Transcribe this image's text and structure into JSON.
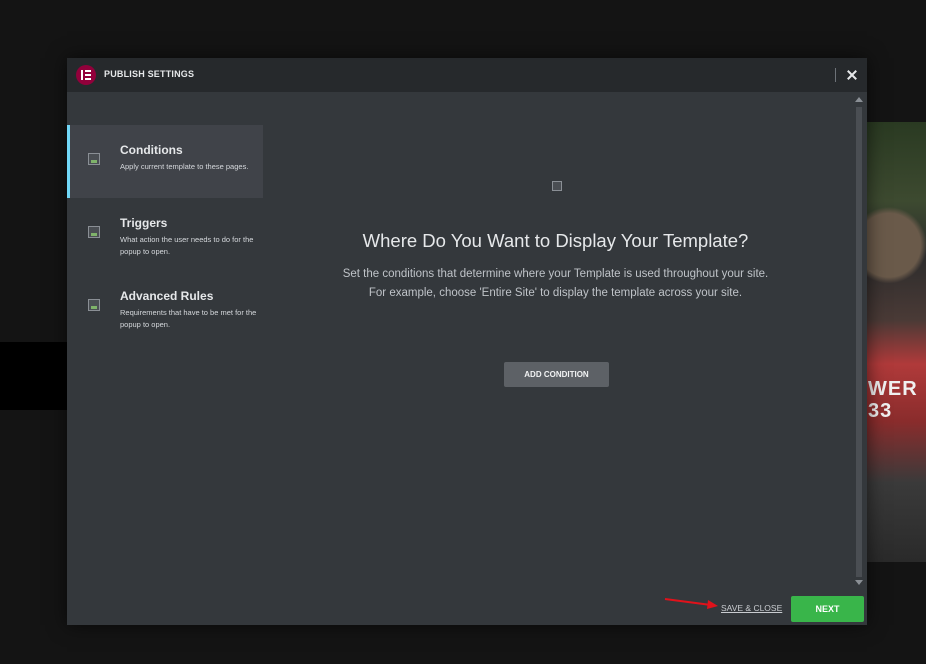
{
  "dialog": {
    "title": "PUBLISH SETTINGS",
    "logo_icon": "elementor-logo-icon",
    "close_icon": "close-icon"
  },
  "sidebar": {
    "items": [
      {
        "title": "Conditions",
        "description": "Apply current template to these pages.",
        "active": true
      },
      {
        "title": "Triggers",
        "description": "What action the user needs to do for the popup to open.",
        "active": false
      },
      {
        "title": "Advanced Rules",
        "description": "Requirements that have to be met for the popup to open.",
        "active": false
      }
    ]
  },
  "main": {
    "heading": "Where Do You Want to Display Your Template?",
    "description_line1": "Set the conditions that determine where your Template is used throughout your site.",
    "description_line2": "For example, choose 'Entire Site' to display the template across your site.",
    "add_condition_label": "ADD CONDITION"
  },
  "footer": {
    "save_close_label": "SAVE & CLOSE",
    "next_label": "NEXT"
  },
  "background": {
    "jersey_text": "WER\n33"
  },
  "colors": {
    "accent_blue": "#71d7f7",
    "next_green": "#39b54a",
    "logo_maroon": "#92003b",
    "annotation_red": "#e0121b"
  }
}
